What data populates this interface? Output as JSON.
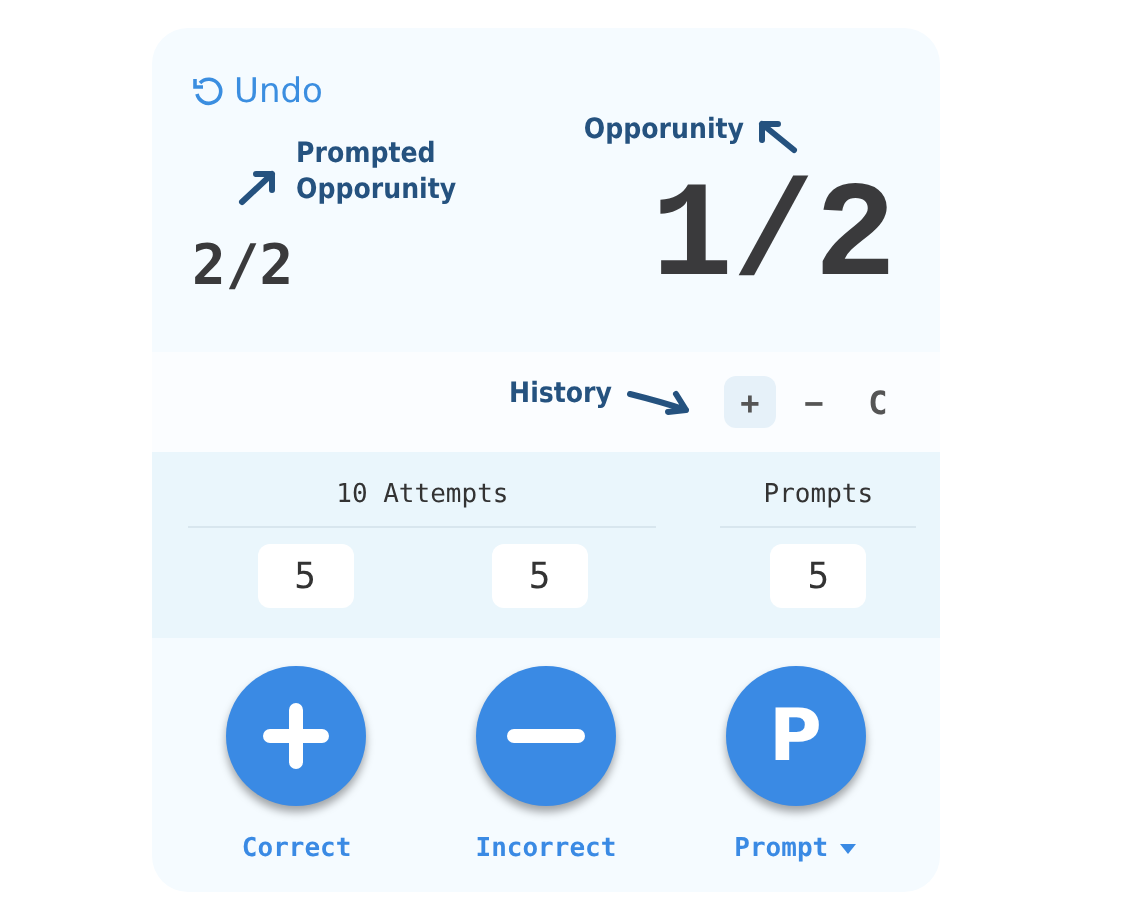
{
  "undo": {
    "label": "Undo"
  },
  "prompted": {
    "annotation": [
      "Prompted",
      "Opporunity"
    ],
    "value": "2/2"
  },
  "opportunity": {
    "annotation": "Opporunity",
    "value": "1/2"
  },
  "history": {
    "annotation": "History",
    "buttons": [
      {
        "label": "+",
        "selected": true
      },
      {
        "label": "−",
        "selected": false
      },
      {
        "label": "C",
        "selected": false
      }
    ]
  },
  "stats": [
    {
      "title": "10 Attempts",
      "values": [
        "5",
        "5"
      ]
    },
    {
      "title": "Prompts",
      "values": [
        "5"
      ]
    }
  ],
  "actions": [
    {
      "kind": "plus",
      "label": "Correct"
    },
    {
      "kind": "minus",
      "label": "Incorrect"
    },
    {
      "kind": "letter",
      "glyph": "P",
      "label": "Prompt",
      "dropdown": true
    }
  ]
}
